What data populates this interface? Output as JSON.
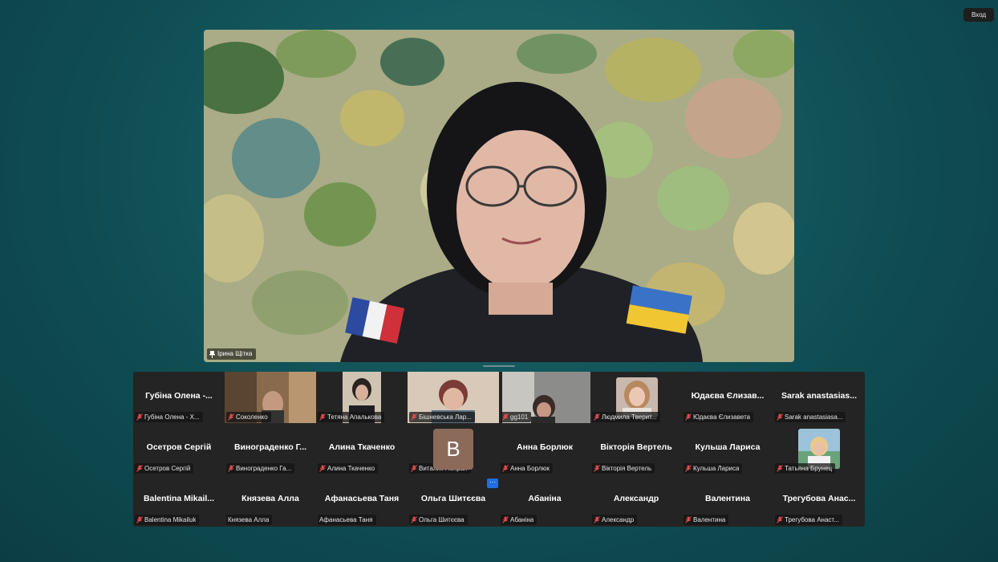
{
  "signin": {
    "label": "Вход"
  },
  "main_speaker": {
    "name": "Ірина Щітка"
  },
  "gallery": {
    "more_label": "···",
    "avatar_letter": "B",
    "tiles": [
      {
        "display": "Губіна Олена -...",
        "label": "Губіна Олена - Х..."
      },
      {
        "display": "",
        "label": "Соколенко"
      },
      {
        "display": "",
        "label": "Тетяна Апалькова"
      },
      {
        "display": "",
        "label": "Бішневська Лар..."
      },
      {
        "display": "",
        "label": "gg101"
      },
      {
        "display": "",
        "label": "Людмила Тверит..."
      },
      {
        "display": "Юдаєва Єлизав...",
        "label": "Юдаєва Єлизавета"
      },
      {
        "display": "Sarak anastasias...",
        "label": "Sarak anastasiasa..."
      },
      {
        "display": "Осетров Сергій",
        "label": "Осетров Сергій"
      },
      {
        "display": "Винограденко Г...",
        "label": "Винограденко Га..."
      },
      {
        "display": "Алина Ткаченко",
        "label": "Алина Ткаченко"
      },
      {
        "display": "",
        "label": "Виталик Непран"
      },
      {
        "display": "Анна Борлюк",
        "label": "Анна Борлюк"
      },
      {
        "display": "Вікторія Вертель",
        "label": "Вікторія Вертель"
      },
      {
        "display": "Кульша Лариса",
        "label": "Кульша Лариса"
      },
      {
        "display": "",
        "label": "Татьяна Брунец"
      },
      {
        "display": "Balentina Mikail...",
        "label": "Balentina Mikailuk"
      },
      {
        "display": "Князева Алла",
        "label": "Князева Алла"
      },
      {
        "display": "Афанасьева Таня",
        "label": "Афанасьева Таня"
      },
      {
        "display": "Ольга Шитєєва",
        "label": "Ольга Шитєєва"
      },
      {
        "display": "Абаніна",
        "label": "Абаніна"
      },
      {
        "display": "Александр",
        "label": "Александр"
      },
      {
        "display": "Валентина",
        "label": "Валентина"
      },
      {
        "display": "Трегубова Анас...",
        "label": "Трегубова Анаст..."
      }
    ]
  }
}
